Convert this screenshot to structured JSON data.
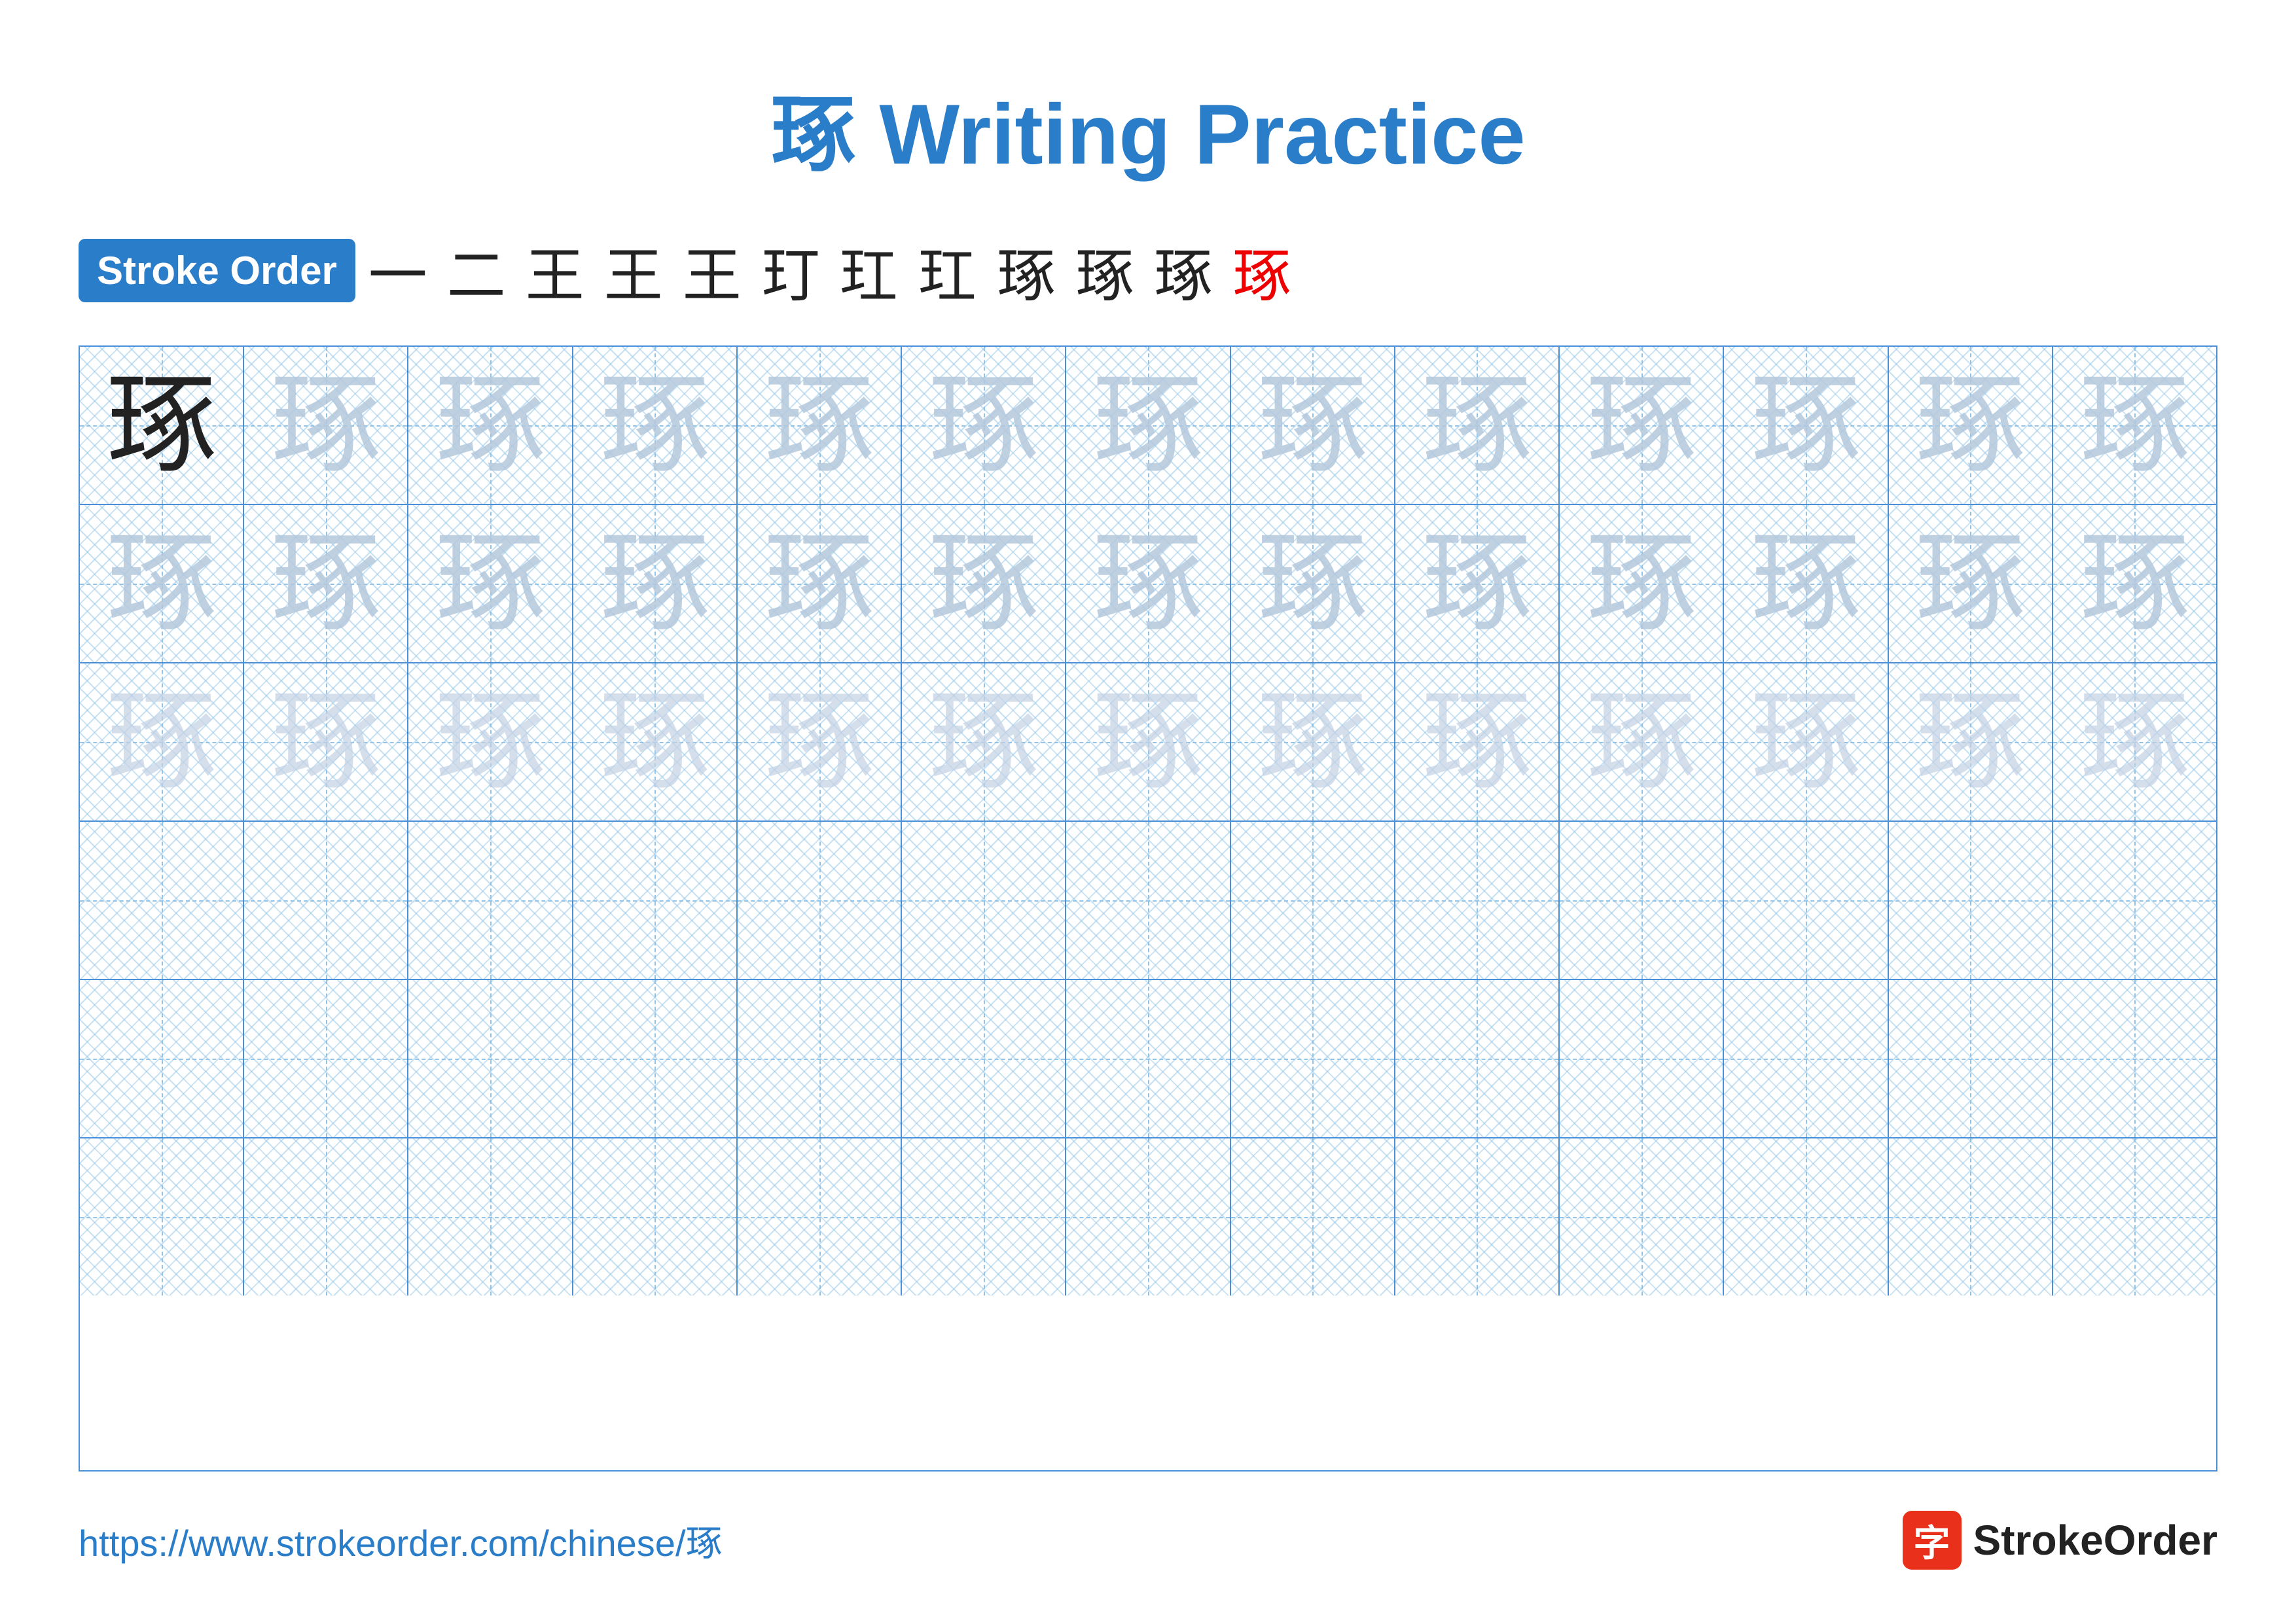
{
  "title": "琢 Writing Practice",
  "stroke_order": {
    "badge_label": "Stroke Order",
    "strokes": [
      "一",
      "二",
      "王",
      "王",
      "王",
      "玎",
      "玎",
      "玒",
      "玒",
      "琢",
      "琢",
      "琢"
    ]
  },
  "character": "琢",
  "grid": {
    "rows": 6,
    "cols": 13,
    "row_types": [
      "dark_then_light1",
      "light1",
      "light2",
      "empty",
      "empty",
      "empty"
    ]
  },
  "footer": {
    "url": "https://www.strokeorder.com/chinese/琢",
    "logo_icon": "字",
    "logo_text": "StrokeOrder"
  }
}
